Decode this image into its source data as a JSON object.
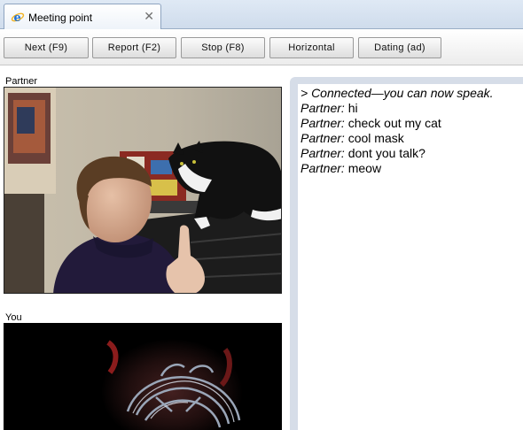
{
  "tab": {
    "title": "Meeting point",
    "close_glyph": "✕",
    "icon": "ie-logo-icon"
  },
  "toolbar": {
    "buttons": [
      {
        "label": "Next (F9)"
      },
      {
        "label": "Report (F2)"
      },
      {
        "label": "Stop (F8)"
      },
      {
        "label": "Horizontal"
      },
      {
        "label": "Dating (ad)"
      }
    ]
  },
  "partner_panel": {
    "label": "Partner",
    "media": "partner-video-feed"
  },
  "you_panel": {
    "label": "You",
    "media": "self-video-feed"
  },
  "chat": {
    "system_message": "> Connected—you can now speak.",
    "messages": [
      {
        "speaker": "Partner:",
        "text": "hi"
      },
      {
        "speaker": "Partner:",
        "text": "check out my cat"
      },
      {
        "speaker": "Partner:",
        "text": "cool mask"
      },
      {
        "speaker": "Partner:",
        "text": "dont you talk?"
      },
      {
        "speaker": "Partner:",
        "text": "meow"
      }
    ]
  },
  "colors": {
    "tab_strip": "#cfdcec",
    "chat_frame": "#d6dde8",
    "ie_blue": "#1f6fd1",
    "ie_gold": "#f2b526"
  }
}
